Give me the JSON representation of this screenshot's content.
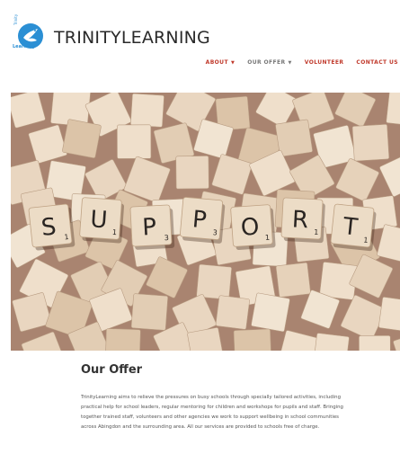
{
  "logo": {
    "small_vertical": "Trinity",
    "small_label": "Learning",
    "brand_color": "#2b8fd4"
  },
  "site_title": "TRINITYLEARNING",
  "nav": [
    {
      "label": "ABOUT",
      "dropdown": true,
      "color": "#c0392b"
    },
    {
      "label": "OUR OFFER",
      "dropdown": true,
      "color": "#777777"
    },
    {
      "label": "VOLUNTEER",
      "dropdown": false,
      "color": "#c0392b"
    },
    {
      "label": "CONTACT US",
      "dropdown": false,
      "color": "#c0392b"
    }
  ],
  "hero": {
    "tiles": [
      {
        "letter": "S",
        "score": "1"
      },
      {
        "letter": "U",
        "score": "1"
      },
      {
        "letter": "P",
        "score": "3"
      },
      {
        "letter": "P",
        "score": "3"
      },
      {
        "letter": "O",
        "score": "1"
      },
      {
        "letter": "R",
        "score": "1"
      },
      {
        "letter": "T",
        "score": "1"
      }
    ]
  },
  "section": {
    "title": "Our Offer",
    "body": "TrinityLearning aims to relieve the pressures on busy schools through specially tailored activities, including practical help for school leaders, regular mentoring for children and workshops for pupils and staff. Bringing together trained staff, volunteers and other agencies we work to support wellbeing in school communities across Abingdon and the surrounding area. All our services are provided to schools free of charge."
  }
}
